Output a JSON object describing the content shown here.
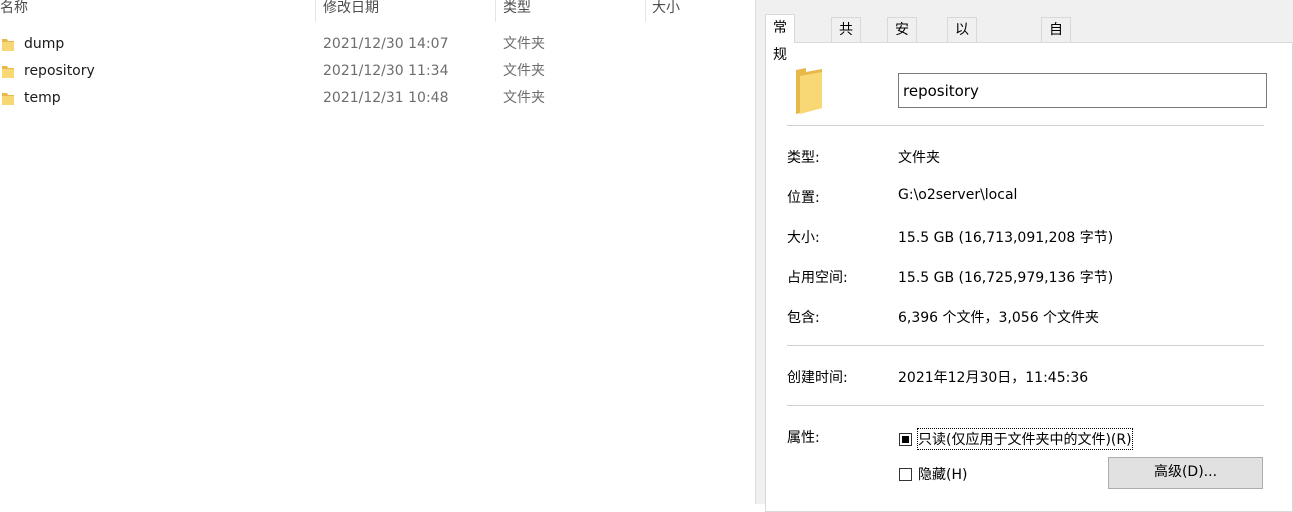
{
  "explorer": {
    "columns": {
      "name": "名称",
      "modified": "修改日期",
      "type": "类型",
      "size": "大小"
    },
    "rows": [
      {
        "name": "dump",
        "modified": "2021/12/30 14:07",
        "type": "文件夹",
        "size": ""
      },
      {
        "name": "repository",
        "modified": "2021/12/30 11:34",
        "type": "文件夹",
        "size": ""
      },
      {
        "name": "temp",
        "modified": "2021/12/31 10:48",
        "type": "文件夹",
        "size": ""
      }
    ],
    "folder_icon": "folder-icon"
  },
  "dialog": {
    "tabs": [
      "常规",
      "共享",
      "安全",
      "以前的版本",
      "自定义"
    ],
    "active_tab": "常规",
    "folder_name": "repository",
    "props": {
      "type_label": "类型:",
      "type_value": "文件夹",
      "location_label": "位置:",
      "location_value": "G:\\o2server\\local",
      "size_label": "大小:",
      "size_value": "15.5 GB (16,713,091,208 字节)",
      "size_on_disk_label": "占用空间:",
      "size_on_disk_value": "15.5 GB (16,725,979,136 字节)",
      "contains_label": "包含:",
      "contains_value": "6,396 个文件，3,056 个文件夹",
      "created_label": "创建时间:",
      "created_value": "2021年12月30日，11:45:36",
      "attributes_label": "属性:"
    },
    "attributes": {
      "readonly_label": "只读(仅应用于文件夹中的文件)(R)",
      "readonly_state": "indeterminate",
      "hidden_label": "隐藏(H)",
      "hidden_state": "unchecked",
      "advanced_button": "高级(D)..."
    }
  },
  "colors": {
    "folder_yellow": "#f8d775",
    "folder_dark": "#e8b84a",
    "dialog_bg": "#f0f0f0",
    "button_bg": "#e1e1e1"
  }
}
